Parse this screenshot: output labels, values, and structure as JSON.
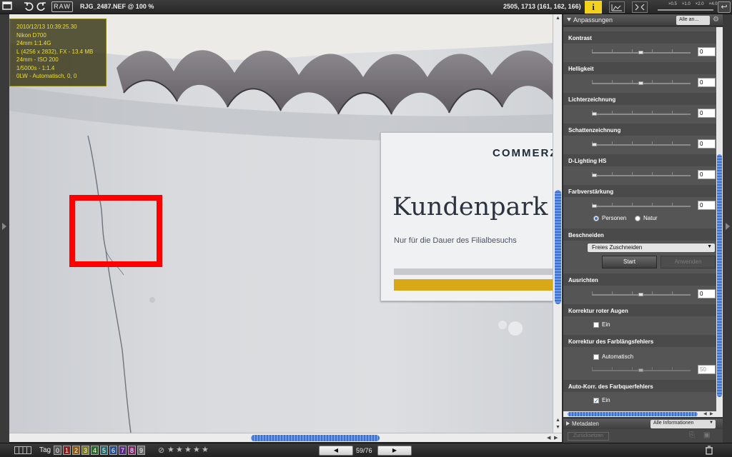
{
  "toolbar": {
    "raw_label": "RAW",
    "file_title": "RJG_2487.NEF @ 100 %",
    "coords": "2505, 1713 (161, 162, 166)",
    "info_label": "i",
    "zoom_levels": [
      "×0.5",
      "×1.0",
      "×2.0",
      "×4.0"
    ]
  },
  "overlay": {
    "lines": [
      "2010/12/13 10:39:25.30",
      "Nikon D700",
      "24mm 1:1.4G",
      "L (4256 x 2832), FX - 13.4 MB",
      "24mm - ISO 200",
      "1/5000s - 1:1.4",
      "0LW - Automatisch, 0, 0"
    ]
  },
  "photo": {
    "sign_brand": "COMMERZ",
    "sign_title": "Kundenpark",
    "sign_subtitle": "Nur für die Dauer des Filialbesuchs"
  },
  "panel": {
    "title": "Anpassungen",
    "select": "Alle an...",
    "sections": {
      "kontrast": {
        "title": "Kontrast",
        "value": "0"
      },
      "helligkeit": {
        "title": "Helligkeit",
        "value": "0"
      },
      "lichter": {
        "title": "Lichterzeichnung",
        "value": "0"
      },
      "schatten": {
        "title": "Schattenzeichnung",
        "value": "0"
      },
      "dlighting": {
        "title": "D-Lighting HS",
        "value": "0"
      },
      "farb": {
        "title": "Farbverstärkung",
        "value": "0",
        "radio_personen": "Personen",
        "radio_natur": "Natur"
      },
      "beschneiden": {
        "title": "Beschneiden",
        "select": "Freies Zuschneiden",
        "start": "Start",
        "apply": "Anwenden"
      },
      "ausrichten": {
        "title": "Ausrichten",
        "value": "0"
      },
      "rote_augen": {
        "title": "Korrektur roter Augen",
        "check": "Ein"
      },
      "farblaengs": {
        "title": "Korrektur des Farblängsfehlers",
        "check": "Automatisch",
        "value": "50"
      },
      "farbquer": {
        "title": "Auto-Korr. des Farbquerfehlers",
        "check": "Ein"
      }
    },
    "metadata_title": "Metadaten",
    "metadata_select": "Alle Informationen",
    "reset": "Zurücksetzen"
  },
  "bottom": {
    "tag_label": "Tag",
    "tags": [
      "0",
      "1",
      "2",
      "3",
      "4",
      "5",
      "6",
      "7",
      "8",
      "9"
    ],
    "tag_colors": [
      "#555555",
      "#8b1d1d",
      "#8a5a1a",
      "#7d7a14",
      "#2f6a2a",
      "#1f6a6a",
      "#2a4c8a",
      "#5a2a8a",
      "#7a2a6a",
      "#6a6a6a"
    ],
    "rating_stars": 5,
    "nav_count": "59/76"
  }
}
